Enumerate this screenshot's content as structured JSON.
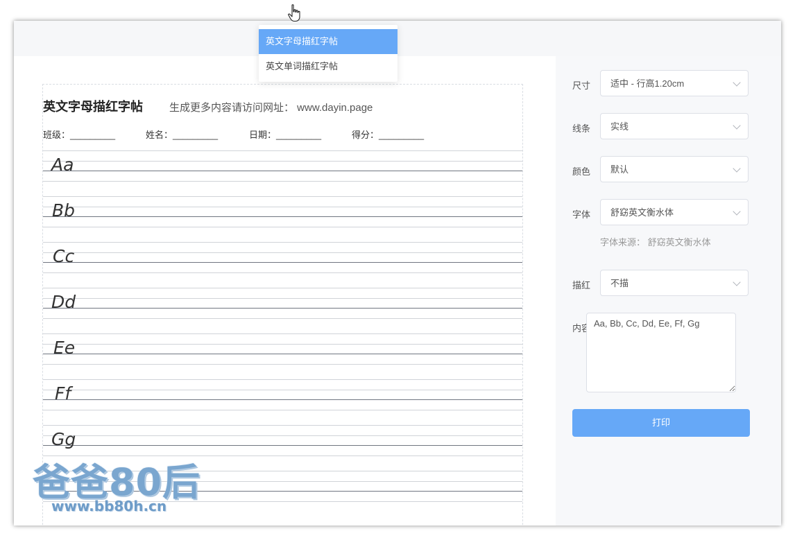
{
  "dropdown": {
    "items": [
      {
        "label": "英文字母描红字帖",
        "active": true
      },
      {
        "label": "英文单词描红字帖",
        "active": false
      }
    ]
  },
  "sheet": {
    "title": "英文字母描红字帖",
    "subtitle": "生成更多内容请访问网址： www.dayin.page",
    "fields": [
      "班级：_________",
      "姓名：_________",
      "日期：_________",
      "得分：_________"
    ],
    "letters": [
      "Aa",
      "Bb",
      "Cc",
      "Dd",
      "Ee",
      "Ff",
      "Gg"
    ]
  },
  "settings": {
    "size": {
      "label": "尺寸",
      "value": "适中 - 行高1.20cm"
    },
    "line": {
      "label": "线条",
      "value": "实线"
    },
    "color": {
      "label": "颜色",
      "value": "默认"
    },
    "font": {
      "label": "字体",
      "value": "舒窈英文衡水体"
    },
    "font_source": "字体来源： 舒窈英文衡水体",
    "trace": {
      "label": "描红",
      "value": "不描"
    },
    "content": {
      "label": "内容",
      "value": "Aa, Bb, Cc, Dd, Ee, Ff, Gg"
    },
    "print_label": "打印"
  },
  "watermark": {
    "title": "爸爸80后",
    "url": "www.bb80h.cn"
  },
  "colors": {
    "accent": "#66a8f7",
    "sidebar_bg": "#f7f8fa"
  }
}
